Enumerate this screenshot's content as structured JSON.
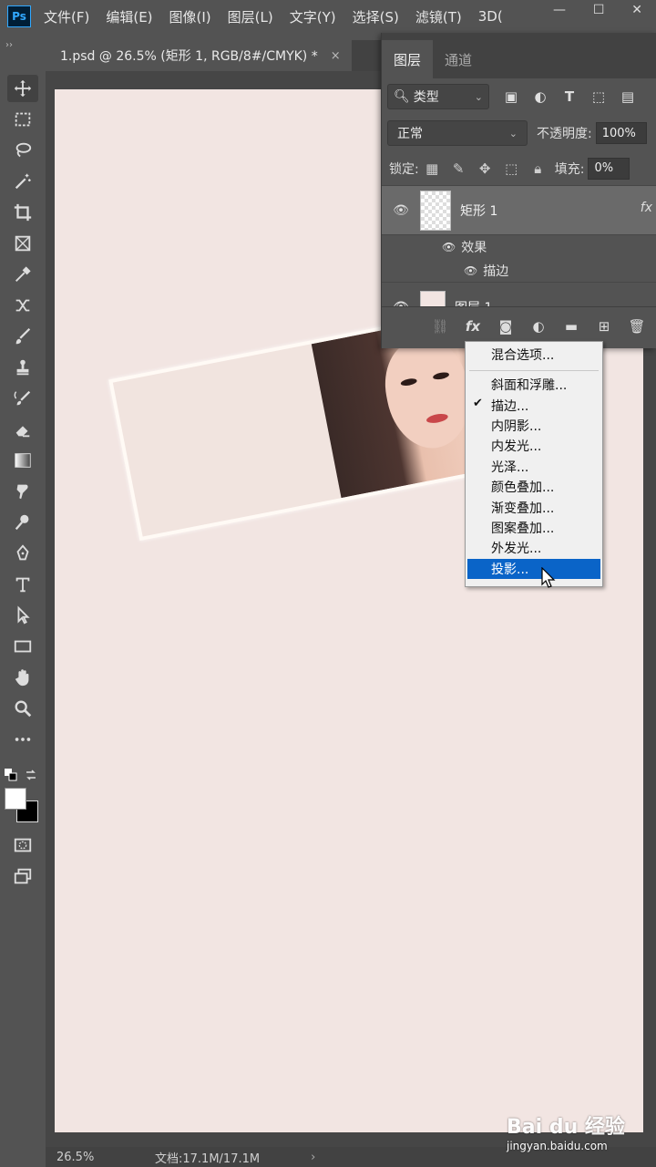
{
  "menubar": {
    "logo": "Ps",
    "items": [
      "文件(F)",
      "编辑(E)",
      "图像(I)",
      "图层(L)",
      "文字(Y)",
      "选择(S)",
      "滤镜(T)",
      "3D("
    ]
  },
  "window_controls": [
    "—",
    "☐",
    "✕"
  ],
  "document_tab": {
    "title": "1.psd @ 26.5% (矩形 1, RGB/8#/CMYK) *",
    "close": "×"
  },
  "status_bar": {
    "zoom": "26.5%",
    "doc_info": "文档:17.1M/17.1M",
    "arrow": "›"
  },
  "layers_panel": {
    "tabs": [
      "图层",
      "通道"
    ],
    "filter_type": "类型",
    "blend_mode": "正常",
    "opacity_label": "不透明度:",
    "opacity_value": "100%",
    "lock_label": "锁定:",
    "fill_label": "填充:",
    "fill_value": "0%",
    "layers": [
      {
        "name": "矩形 1",
        "right": "fx"
      },
      {
        "name": "图层 1"
      }
    ],
    "effects_label": "效果",
    "effect_stroke": "描边"
  },
  "fx_menu": {
    "blend_options": "混合选项...",
    "items": [
      "斜面和浮雕...",
      "描边...",
      "内阴影...",
      "内发光...",
      "光泽...",
      "颜色叠加...",
      "渐变叠加...",
      "图案叠加...",
      "外发光...",
      "投影..."
    ],
    "checked": "描边...",
    "highlighted": "投影..."
  },
  "watermark": {
    "logo": "Bai du 经验",
    "url": "jingyan.baidu.com"
  },
  "colors": {
    "canvas_bg": "#f2e5e2",
    "highlight": "#0a64c8",
    "ps_blue": "#31a8ff"
  }
}
